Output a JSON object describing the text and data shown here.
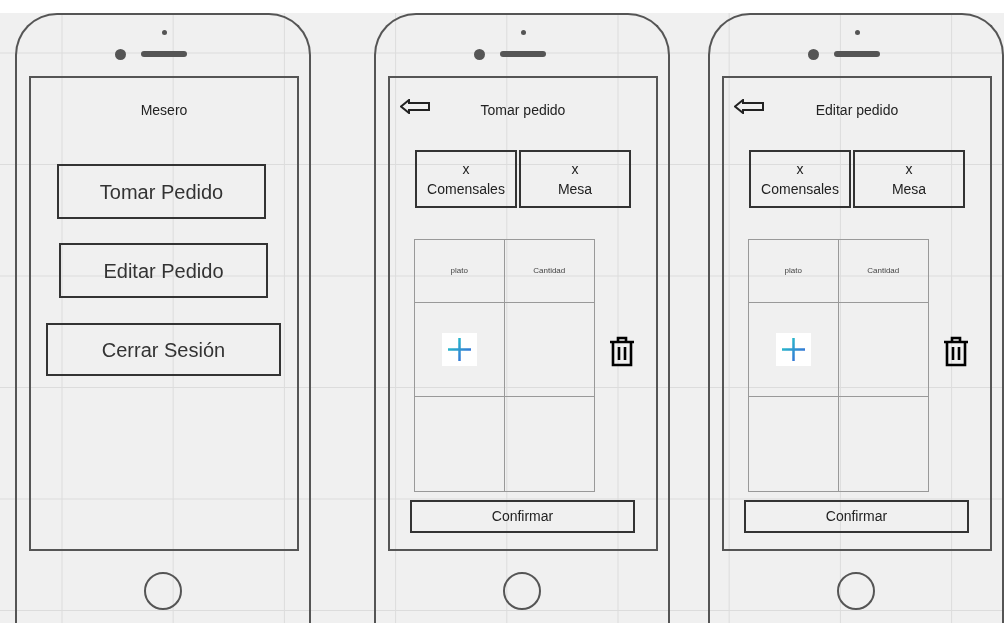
{
  "phones": [
    {
      "kind": "menu",
      "title": "Mesero",
      "buttons": [
        "Tomar Pedido",
        "Editar Pedido",
        "Cerrar Sesión"
      ]
    },
    {
      "kind": "order",
      "title": "Tomar pedido",
      "fields": [
        {
          "value": "x",
          "label": "Comensales"
        },
        {
          "value": "x",
          "label": "Mesa"
        }
      ],
      "table": {
        "columns": [
          "plato",
          "Cantidad"
        ]
      },
      "confirm": "Confirmar"
    },
    {
      "kind": "order",
      "title": "Editar pedido",
      "fields": [
        {
          "value": "x",
          "label": "Comensales"
        },
        {
          "value": "x",
          "label": "Mesa"
        }
      ],
      "table": {
        "columns": [
          "plato",
          "Cantidad"
        ]
      },
      "confirm": "Confirmar"
    }
  ]
}
